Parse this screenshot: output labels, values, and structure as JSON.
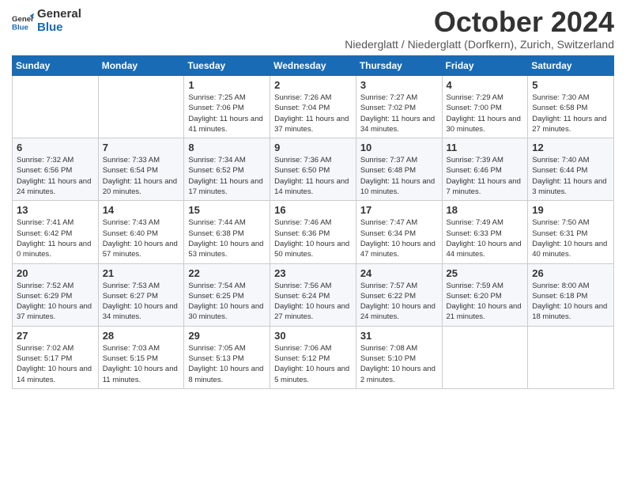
{
  "logo": {
    "line1": "General",
    "line2": "Blue"
  },
  "title": "October 2024",
  "subtitle": "Niederglatt / Niederglatt (Dorfkern), Zurich, Switzerland",
  "header_color": "#1a6bb5",
  "days_of_week": [
    "Sunday",
    "Monday",
    "Tuesday",
    "Wednesday",
    "Thursday",
    "Friday",
    "Saturday"
  ],
  "weeks": [
    [
      {
        "day": "",
        "info": ""
      },
      {
        "day": "",
        "info": ""
      },
      {
        "day": "1",
        "info": "Sunrise: 7:25 AM\nSunset: 7:06 PM\nDaylight: 11 hours and 41 minutes."
      },
      {
        "day": "2",
        "info": "Sunrise: 7:26 AM\nSunset: 7:04 PM\nDaylight: 11 hours and 37 minutes."
      },
      {
        "day": "3",
        "info": "Sunrise: 7:27 AM\nSunset: 7:02 PM\nDaylight: 11 hours and 34 minutes."
      },
      {
        "day": "4",
        "info": "Sunrise: 7:29 AM\nSunset: 7:00 PM\nDaylight: 11 hours and 30 minutes."
      },
      {
        "day": "5",
        "info": "Sunrise: 7:30 AM\nSunset: 6:58 PM\nDaylight: 11 hours and 27 minutes."
      }
    ],
    [
      {
        "day": "6",
        "info": "Sunrise: 7:32 AM\nSunset: 6:56 PM\nDaylight: 11 hours and 24 minutes."
      },
      {
        "day": "7",
        "info": "Sunrise: 7:33 AM\nSunset: 6:54 PM\nDaylight: 11 hours and 20 minutes."
      },
      {
        "day": "8",
        "info": "Sunrise: 7:34 AM\nSunset: 6:52 PM\nDaylight: 11 hours and 17 minutes."
      },
      {
        "day": "9",
        "info": "Sunrise: 7:36 AM\nSunset: 6:50 PM\nDaylight: 11 hours and 14 minutes."
      },
      {
        "day": "10",
        "info": "Sunrise: 7:37 AM\nSunset: 6:48 PM\nDaylight: 11 hours and 10 minutes."
      },
      {
        "day": "11",
        "info": "Sunrise: 7:39 AM\nSunset: 6:46 PM\nDaylight: 11 hours and 7 minutes."
      },
      {
        "day": "12",
        "info": "Sunrise: 7:40 AM\nSunset: 6:44 PM\nDaylight: 11 hours and 3 minutes."
      }
    ],
    [
      {
        "day": "13",
        "info": "Sunrise: 7:41 AM\nSunset: 6:42 PM\nDaylight: 11 hours and 0 minutes."
      },
      {
        "day": "14",
        "info": "Sunrise: 7:43 AM\nSunset: 6:40 PM\nDaylight: 10 hours and 57 minutes."
      },
      {
        "day": "15",
        "info": "Sunrise: 7:44 AM\nSunset: 6:38 PM\nDaylight: 10 hours and 53 minutes."
      },
      {
        "day": "16",
        "info": "Sunrise: 7:46 AM\nSunset: 6:36 PM\nDaylight: 10 hours and 50 minutes."
      },
      {
        "day": "17",
        "info": "Sunrise: 7:47 AM\nSunset: 6:34 PM\nDaylight: 10 hours and 47 minutes."
      },
      {
        "day": "18",
        "info": "Sunrise: 7:49 AM\nSunset: 6:33 PM\nDaylight: 10 hours and 44 minutes."
      },
      {
        "day": "19",
        "info": "Sunrise: 7:50 AM\nSunset: 6:31 PM\nDaylight: 10 hours and 40 minutes."
      }
    ],
    [
      {
        "day": "20",
        "info": "Sunrise: 7:52 AM\nSunset: 6:29 PM\nDaylight: 10 hours and 37 minutes."
      },
      {
        "day": "21",
        "info": "Sunrise: 7:53 AM\nSunset: 6:27 PM\nDaylight: 10 hours and 34 minutes."
      },
      {
        "day": "22",
        "info": "Sunrise: 7:54 AM\nSunset: 6:25 PM\nDaylight: 10 hours and 30 minutes."
      },
      {
        "day": "23",
        "info": "Sunrise: 7:56 AM\nSunset: 6:24 PM\nDaylight: 10 hours and 27 minutes."
      },
      {
        "day": "24",
        "info": "Sunrise: 7:57 AM\nSunset: 6:22 PM\nDaylight: 10 hours and 24 minutes."
      },
      {
        "day": "25",
        "info": "Sunrise: 7:59 AM\nSunset: 6:20 PM\nDaylight: 10 hours and 21 minutes."
      },
      {
        "day": "26",
        "info": "Sunrise: 8:00 AM\nSunset: 6:18 PM\nDaylight: 10 hours and 18 minutes."
      }
    ],
    [
      {
        "day": "27",
        "info": "Sunrise: 7:02 AM\nSunset: 5:17 PM\nDaylight: 10 hours and 14 minutes."
      },
      {
        "day": "28",
        "info": "Sunrise: 7:03 AM\nSunset: 5:15 PM\nDaylight: 10 hours and 11 minutes."
      },
      {
        "day": "29",
        "info": "Sunrise: 7:05 AM\nSunset: 5:13 PM\nDaylight: 10 hours and 8 minutes."
      },
      {
        "day": "30",
        "info": "Sunrise: 7:06 AM\nSunset: 5:12 PM\nDaylight: 10 hours and 5 minutes."
      },
      {
        "day": "31",
        "info": "Sunrise: 7:08 AM\nSunset: 5:10 PM\nDaylight: 10 hours and 2 minutes."
      },
      {
        "day": "",
        "info": ""
      },
      {
        "day": "",
        "info": ""
      }
    ]
  ]
}
